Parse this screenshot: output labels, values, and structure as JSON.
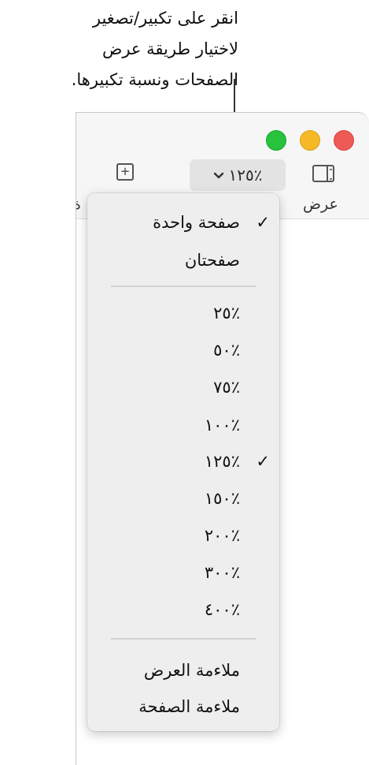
{
  "callout": {
    "line1": "انقر على تكبير/تصغير",
    "line2": "لاختيار طريقة عرض",
    "line3": "الصفحات ونسبة تكبيرها."
  },
  "toolbar": {
    "zoom_value": "٪١٢٥",
    "view_label": "عرض",
    "cut_label": "ة"
  },
  "menu": {
    "layout_items": [
      {
        "label": "صفحة واحدة",
        "checked": "✓"
      },
      {
        "label": "صفحتان",
        "checked": ""
      }
    ],
    "zoom_items": [
      {
        "label": "٪٢٥",
        "checked": ""
      },
      {
        "label": "٪٥٠",
        "checked": ""
      },
      {
        "label": "٪٧٥",
        "checked": ""
      },
      {
        "label": "٪١٠٠",
        "checked": ""
      },
      {
        "label": "٪١٢٥",
        "checked": "✓"
      },
      {
        "label": "٪١٥٠",
        "checked": ""
      },
      {
        "label": "٪٢٠٠",
        "checked": ""
      },
      {
        "label": "٪٣٠٠",
        "checked": ""
      },
      {
        "label": "٪٤٠٠",
        "checked": ""
      }
    ],
    "fit_items": [
      {
        "label": "ملاءمة العرض"
      },
      {
        "label": "ملاءمة الصفحة"
      }
    ]
  },
  "colors": {
    "close": "#ee5b56",
    "minimize": "#f4b924",
    "zoom": "#29c23c"
  }
}
